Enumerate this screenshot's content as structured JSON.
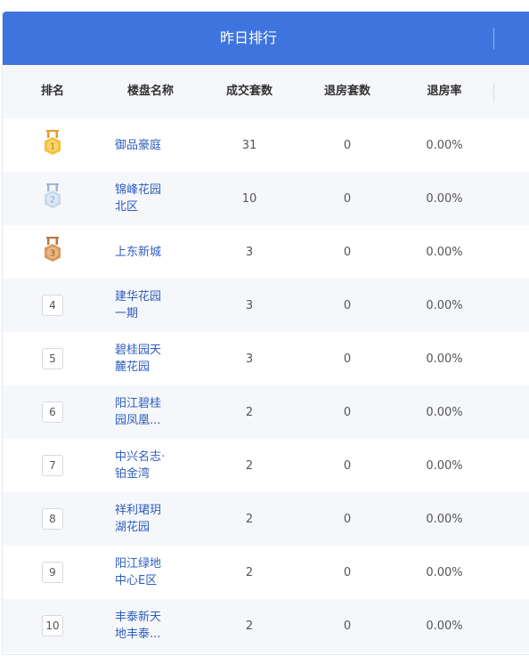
{
  "title": "昨日排行",
  "columns": {
    "rank": "排名",
    "name": "楼盘名称",
    "deals": "成交套数",
    "returns": "退房套数",
    "rate": "退房率"
  },
  "colors": {
    "accent": "#3f74de",
    "link": "#2d5dbf",
    "gold": "#f2b531",
    "silver": "#c8d8ea",
    "bronze": "#d89a5b"
  },
  "rows": [
    {
      "rank": "1",
      "medal": "gold-medal-icon",
      "name": "御品豪庭",
      "deals": "31",
      "returns": "0",
      "rate": "0.00%"
    },
    {
      "rank": "2",
      "medal": "silver-medal-icon",
      "name": "锦峰花园北区",
      "deals": "10",
      "returns": "0",
      "rate": "0.00%"
    },
    {
      "rank": "3",
      "medal": "bronze-medal-icon",
      "name": "上东新城",
      "deals": "3",
      "returns": "0",
      "rate": "0.00%"
    },
    {
      "rank": "4",
      "name": "建华花园一期",
      "deals": "3",
      "returns": "0",
      "rate": "0.00%"
    },
    {
      "rank": "5",
      "name": "碧桂园天麓花园",
      "deals": "3",
      "returns": "0",
      "rate": "0.00%"
    },
    {
      "rank": "6",
      "name": "阳江碧桂园凤凰...",
      "deals": "2",
      "returns": "0",
      "rate": "0.00%"
    },
    {
      "rank": "7",
      "name": "中兴名志·铂金湾",
      "deals": "2",
      "returns": "0",
      "rate": "0.00%"
    },
    {
      "rank": "8",
      "name": "祥利珺玥湖花园",
      "deals": "2",
      "returns": "0",
      "rate": "0.00%"
    },
    {
      "rank": "9",
      "name": "阳江绿地中心E区",
      "deals": "2",
      "returns": "0",
      "rate": "0.00%"
    },
    {
      "rank": "10",
      "name": "丰泰新天地丰泰...",
      "deals": "2",
      "returns": "0",
      "rate": "0.00%"
    }
  ]
}
